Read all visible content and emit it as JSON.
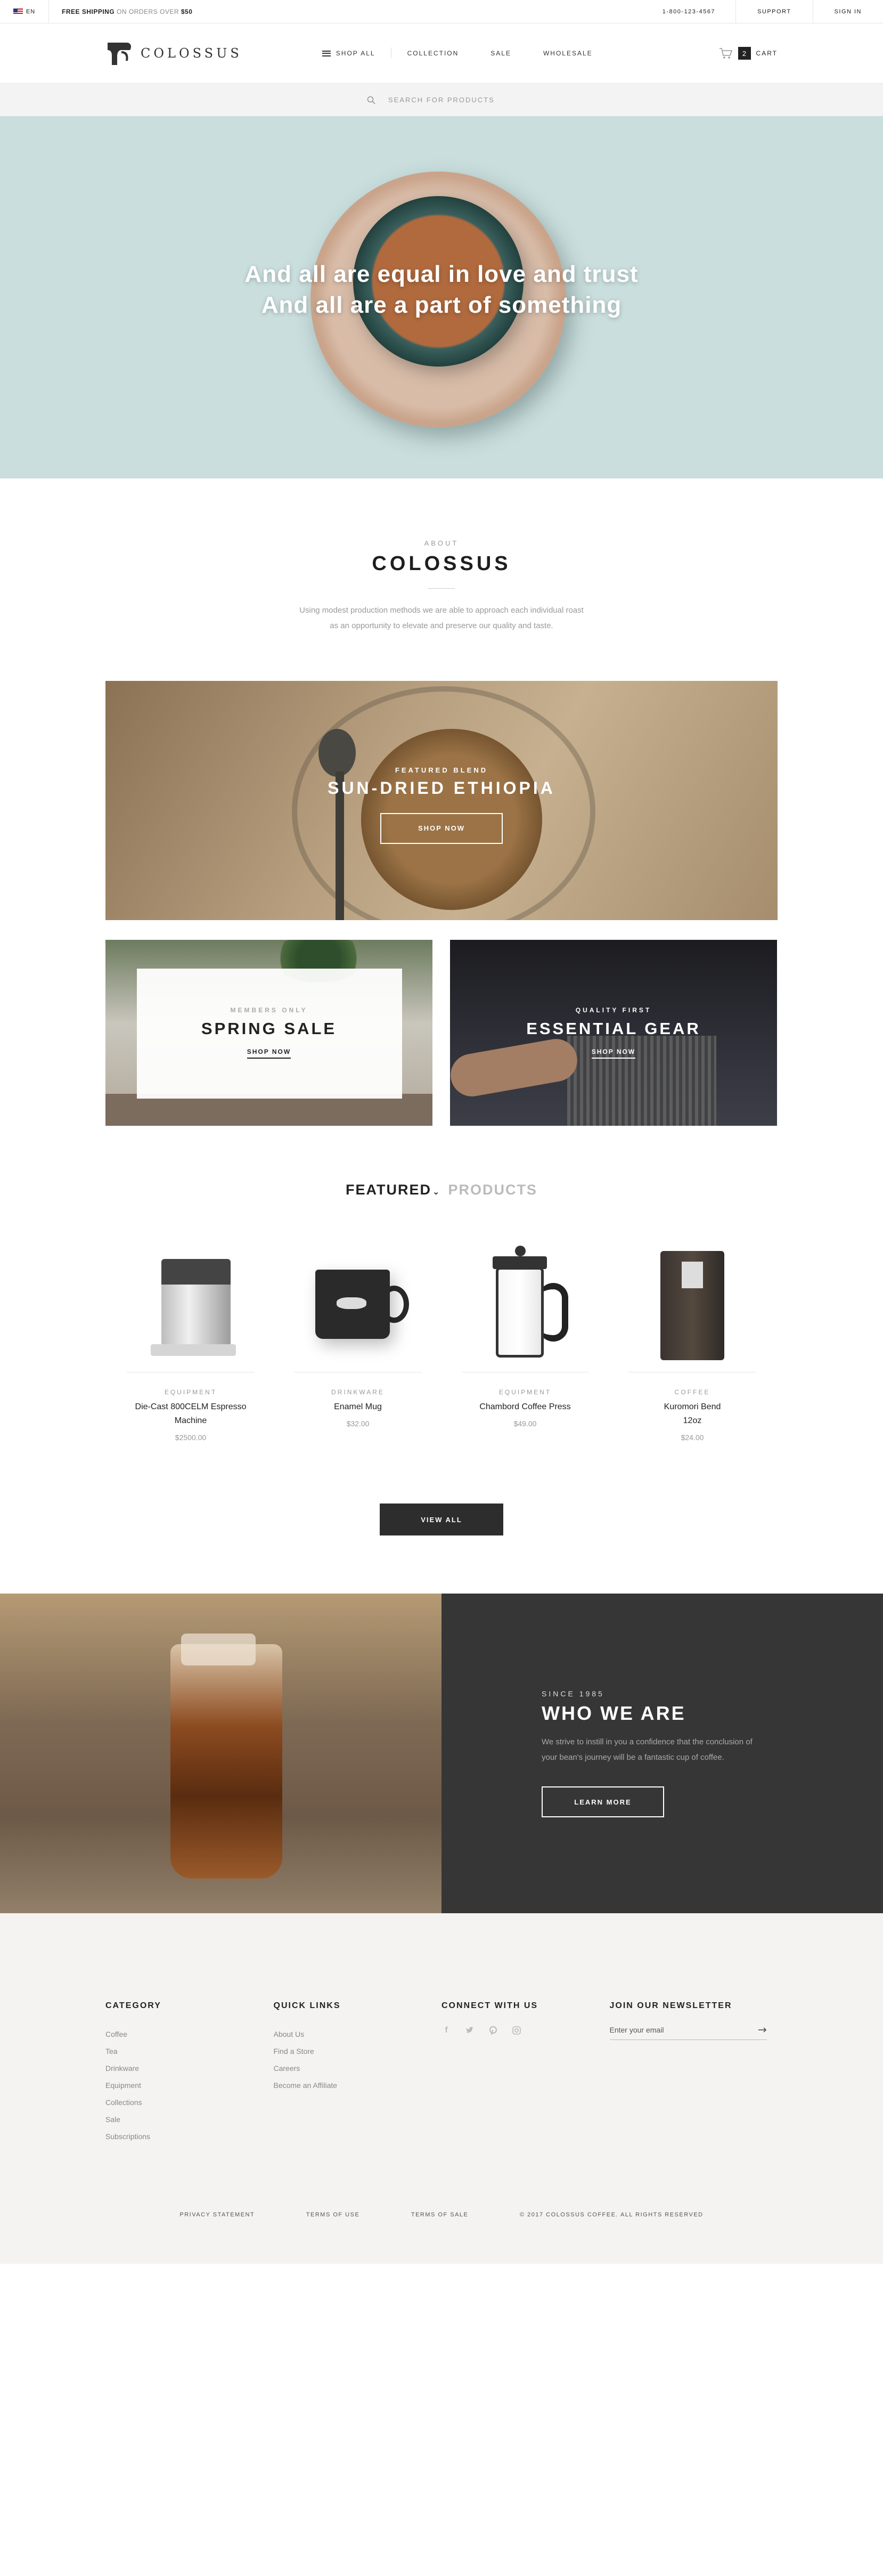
{
  "topbar": {
    "lang": "EN",
    "ship_bold": "FREE SHIPPING",
    "ship_mid": " ON ORDERS OVER ",
    "ship_amount": "$50",
    "phone": "1-800-123-4567",
    "support": "SUPPORT",
    "signin": "SIGN IN"
  },
  "header": {
    "logo_text": "COLOSSUS",
    "nav": [
      "SHOP ALL",
      "COLLECTION",
      "SALE",
      "WHOLESALE"
    ],
    "cart_count": "2",
    "cart_label": "CART"
  },
  "search": {
    "placeholder": "SEARCH FOR PRODUCTS"
  },
  "hero": {
    "line1": "And all are equal in love and trust",
    "line2": "And all are a part of something"
  },
  "about": {
    "eyebrow": "ABOUT",
    "title": "COLOSSUS",
    "desc_line1": "Using modest production methods we are able to approach each individual roast",
    "desc_line2": "as an opportunity to elevate and preserve our quality and taste."
  },
  "promo": {
    "eyebrow": "FEATURED BLEND",
    "title": "SUN-DRIED ETHIOPIA",
    "button": "SHOP NOW"
  },
  "tiles": [
    {
      "eyebrow": "MEMBERS ONLY",
      "title": "SPRING SALE",
      "link": "SHOP NOW"
    },
    {
      "eyebrow": "QUALITY FIRST",
      "title": "ESSENTIAL GEAR",
      "link": "SHOP NOW"
    }
  ],
  "featured_tabs": {
    "active": "FEATURED",
    "inactive": "PRODUCTS"
  },
  "products": [
    {
      "category": "EQUIPMENT",
      "name_l1": "Die-Cast 800CELM Espresso",
      "name_l2": "Machine",
      "price": "$2500.00"
    },
    {
      "category": "DRINKWARE",
      "name_l1": "Enamel Mug",
      "name_l2": "",
      "price": "$32.00"
    },
    {
      "category": "EQUIPMENT",
      "name_l1": "Chambord Coffee Press",
      "name_l2": "",
      "price": "$49.00"
    },
    {
      "category": "COFFEE",
      "name_l1": "Kuromori Bend",
      "name_l2": "12oz",
      "price": "$24.00"
    }
  ],
  "view_all": "VIEW ALL",
  "who": {
    "eyebrow": "SINCE 1985",
    "title": "WHO WE ARE",
    "desc_line1": "We strive to instill in you a confidence that the conclusion of",
    "desc_line2": "your bean's journey will be a fantastic cup of coffee.",
    "button": "LEARN MORE"
  },
  "footer": {
    "category": {
      "title": "CATEGORY",
      "items": [
        "Coffee",
        "Tea",
        "Drinkware",
        "Equipment",
        "Collections",
        "Sale",
        "Subscriptions"
      ]
    },
    "quick_links": {
      "title": "QUICK LINKS",
      "items": [
        "About Us",
        "Find a Store",
        "Careers",
        "Become an Affiliate"
      ]
    },
    "connect": {
      "title": "CONNECT WITH US",
      "icons": [
        "facebook-icon",
        "twitter-icon",
        "pinterest-icon",
        "instagram-icon"
      ]
    },
    "newsletter": {
      "title": "JOIN OUR NEWSLETTER",
      "placeholder": "Enter your email"
    },
    "bottom": [
      "PRIVACY STATEMENT",
      "TERMS OF USE",
      "TERMS OF SALE",
      "© 2017 COLOSSUS COFFEE. ALL RIGHTS RESERVED"
    ]
  }
}
